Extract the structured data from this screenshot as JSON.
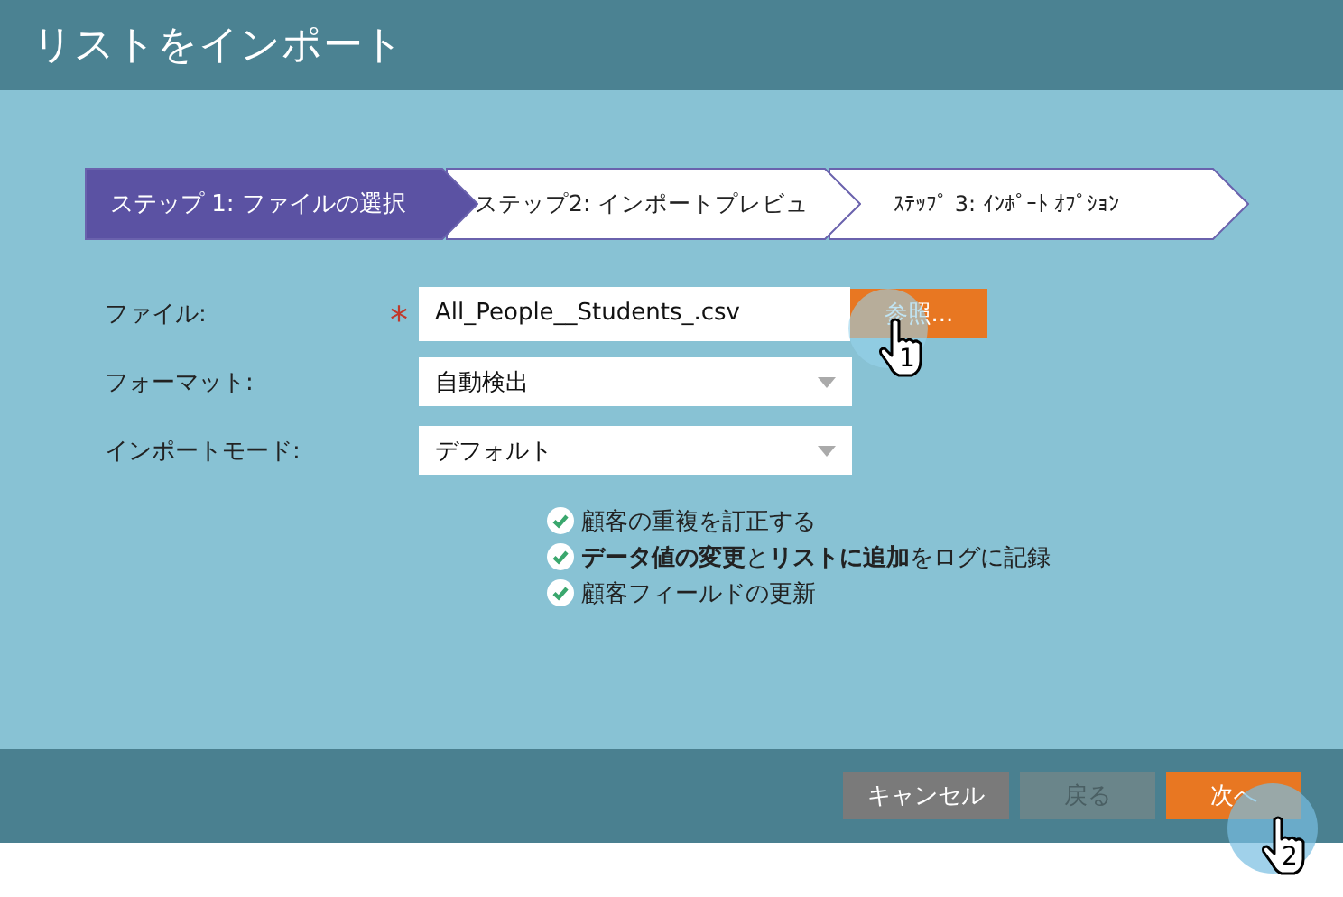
{
  "window": {
    "title": "リストをインポート"
  },
  "steps": [
    {
      "label": "ステップ 1: ファイルの選択",
      "selected": true
    },
    {
      "label": "ステップ2: インポートプレビュ",
      "selected": false
    },
    {
      "label": "ｽﾃｯﾌﾟ 3: ｲﾝﾎﾟｰﾄ ｵﾌﾟｼｮﾝ",
      "selected": false
    }
  ],
  "fields": [
    {
      "kind": "file",
      "label": "ファイル:",
      "required_mark": "*",
      "value": "All_People__Students_.csv",
      "button": "参照..."
    },
    {
      "kind": "select",
      "label": "フォーマット:",
      "value": "自動検出"
    },
    {
      "kind": "select",
      "label": "インポートモード:",
      "value": "デフォルト"
    }
  ],
  "options": [
    {
      "text": "顧客の重複を訂正する",
      "checked": true
    },
    {
      "text": "**データ値の変更**と**リストに追加**をログに記録",
      "checked": true
    },
    {
      "text": "顧客フィールドの更新",
      "checked": true
    }
  ],
  "buttons": [
    {
      "label": "キャンセル",
      "kind": "secondary",
      "disabled": false
    },
    {
      "label": "戻る",
      "kind": "secondary",
      "disabled": true
    },
    {
      "label": "次へ",
      "kind": "primary",
      "disabled": false
    }
  ],
  "markers": [
    {
      "number": "1"
    },
    {
      "number": "2"
    }
  ]
}
